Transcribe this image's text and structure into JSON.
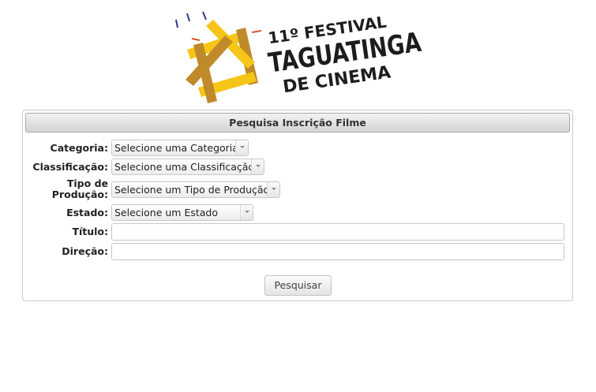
{
  "logo": {
    "line1": "11º FESTIVAL",
    "line2": "TAGUATINGA",
    "line3": "DE CINEMA",
    "icon": "film-star-logo",
    "colors": {
      "yellow": "#f5c518",
      "brown": "#c08a2a",
      "dark": "#1d1d1b"
    }
  },
  "panel": {
    "title": "Pesquisa Inscrição Filme"
  },
  "form": {
    "categoria": {
      "label": "Categoria:",
      "value": "Selecione uma Categoria"
    },
    "classificacao": {
      "label": "Classificação:",
      "value": "Selecione uma Classificação"
    },
    "tipo_producao": {
      "label_line1": "Tipo de",
      "label_line2": "Produção:",
      "value": "Selecione um Tipo de Produção"
    },
    "estado": {
      "label": "Estado:",
      "value": "Selecione um Estado"
    },
    "titulo": {
      "label": "Título:",
      "value": ""
    },
    "direcao": {
      "label": "Direção:",
      "value": ""
    },
    "submit_label": "Pesquisar"
  }
}
